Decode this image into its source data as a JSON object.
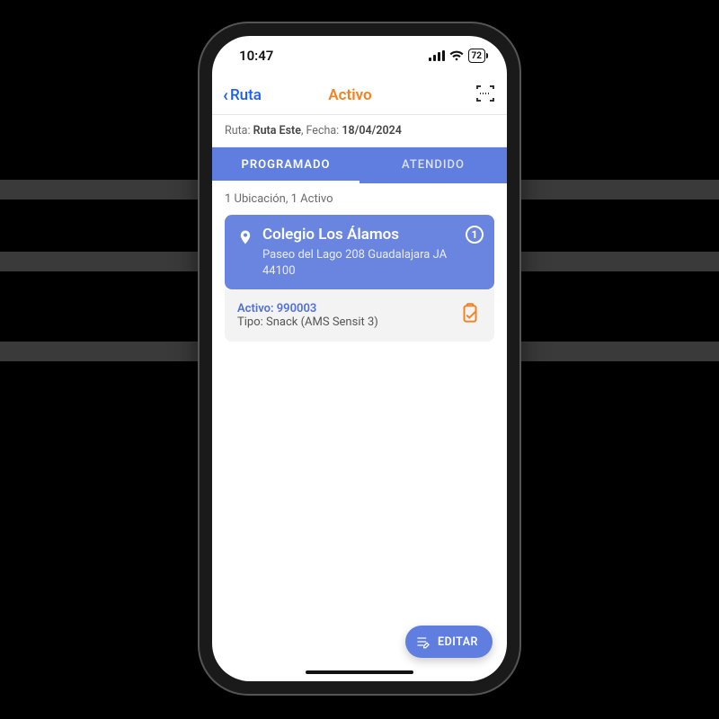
{
  "status": {
    "time": "10:47",
    "battery": "72"
  },
  "nav": {
    "back": "Ruta",
    "title": "Activo"
  },
  "route": {
    "label_ruta": "Ruta:",
    "route_name": "Ruta Este",
    "label_fecha": "Fecha:",
    "date": "18/04/2024"
  },
  "tabs": {
    "programado": "PROGRAMADO",
    "atendido": "ATENDIDO"
  },
  "summary": "1 Ubicación, 1 Activo",
  "location": {
    "title": "Colegio Los Álamos",
    "address": "Paseo del Lago 208 Guadalajara JA 44100",
    "count": "1"
  },
  "asset": {
    "id_label": "Activo: 990003",
    "type_label": "Tipo: Snack (AMS Sensit 3)"
  },
  "fab": {
    "label": "EDITAR"
  }
}
